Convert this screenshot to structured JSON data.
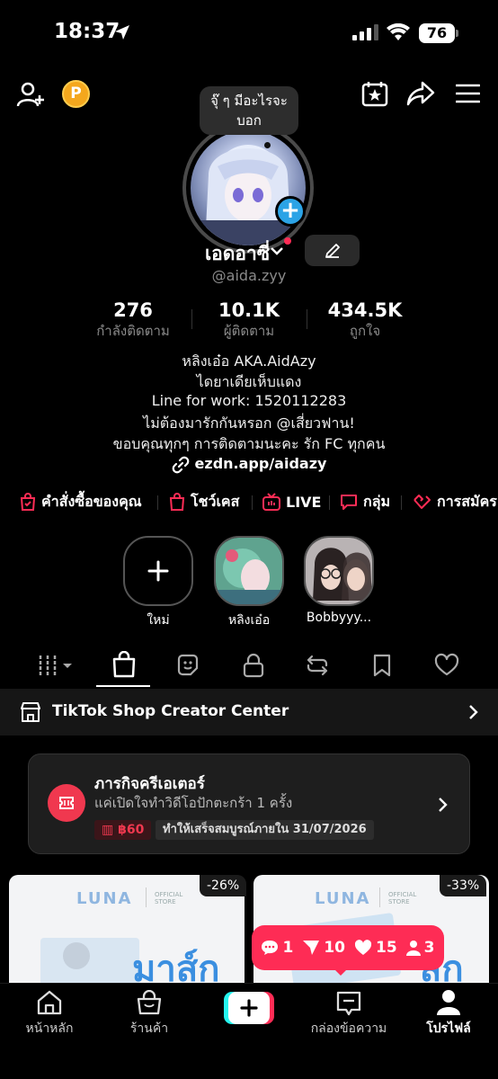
{
  "status_bar": {
    "time": "18:37",
    "battery": "76"
  },
  "profile": {
    "bubble_text": "จุ๊ ๆ มีอะไรจะบอก",
    "name": "เอดอาซี่",
    "handle": "@aida.zyy",
    "stats": [
      {
        "value": "276",
        "label": "กำลังติดตาม"
      },
      {
        "value": "10.1K",
        "label": "ผู้ติดตาม"
      },
      {
        "value": "434.5K",
        "label": "ถูกใจ"
      }
    ],
    "bio": [
      "หลิงเอ๋อ AKA.AidAzy",
      "ไดยาเดียเห็บแดง",
      "Line for work: 1520112283",
      "ไม่ต้องมารักกันหรอก @เสี่ยวฟาน!",
      "ขอบคุณทุกๆ การติดตามนะคะ รัก FC ทุกคน"
    ],
    "link": "ezdn.app/aidazy"
  },
  "quick_actions": [
    "คำสั่งซื้อของคุณ",
    "โชว์เคส",
    "LIVE",
    "กลุ่ม",
    "การสมัคร"
  ],
  "highlights": [
    "ใหม่",
    "หลิงเอ๋อ",
    "Bobbyyy..."
  ],
  "shop": {
    "title": "TikTok Shop Creator Center"
  },
  "creator_mission": {
    "title": "ภารกิจครีเอเตอร์",
    "subtitle": "แค่เปิดใจทำวิดีโอปักตะกร้า 1 ครั้ง",
    "reward": "฿60",
    "deadline": "ทำให้เสร็จสมบูรณ์ภายใน 31/07/2026"
  },
  "products": [
    {
      "discount": "-26%",
      "brand": "LUNA",
      "store": "OFFICIAL STORE",
      "headline": "มาส์ก"
    },
    {
      "discount": "-33%",
      "brand": "LUNA",
      "store": "OFFICIAL STORE",
      "headline": "สก"
    }
  ],
  "notifications": {
    "comments": "1",
    "shares": "10",
    "likes": "15",
    "followers": "3"
  },
  "bottom_nav": [
    "หน้าหลัก",
    "ร้านค้า",
    "กล่องข้อความ",
    "โปรไฟล์"
  ],
  "colors": {
    "accent": "#fe2c55",
    "background": "#000000"
  }
}
